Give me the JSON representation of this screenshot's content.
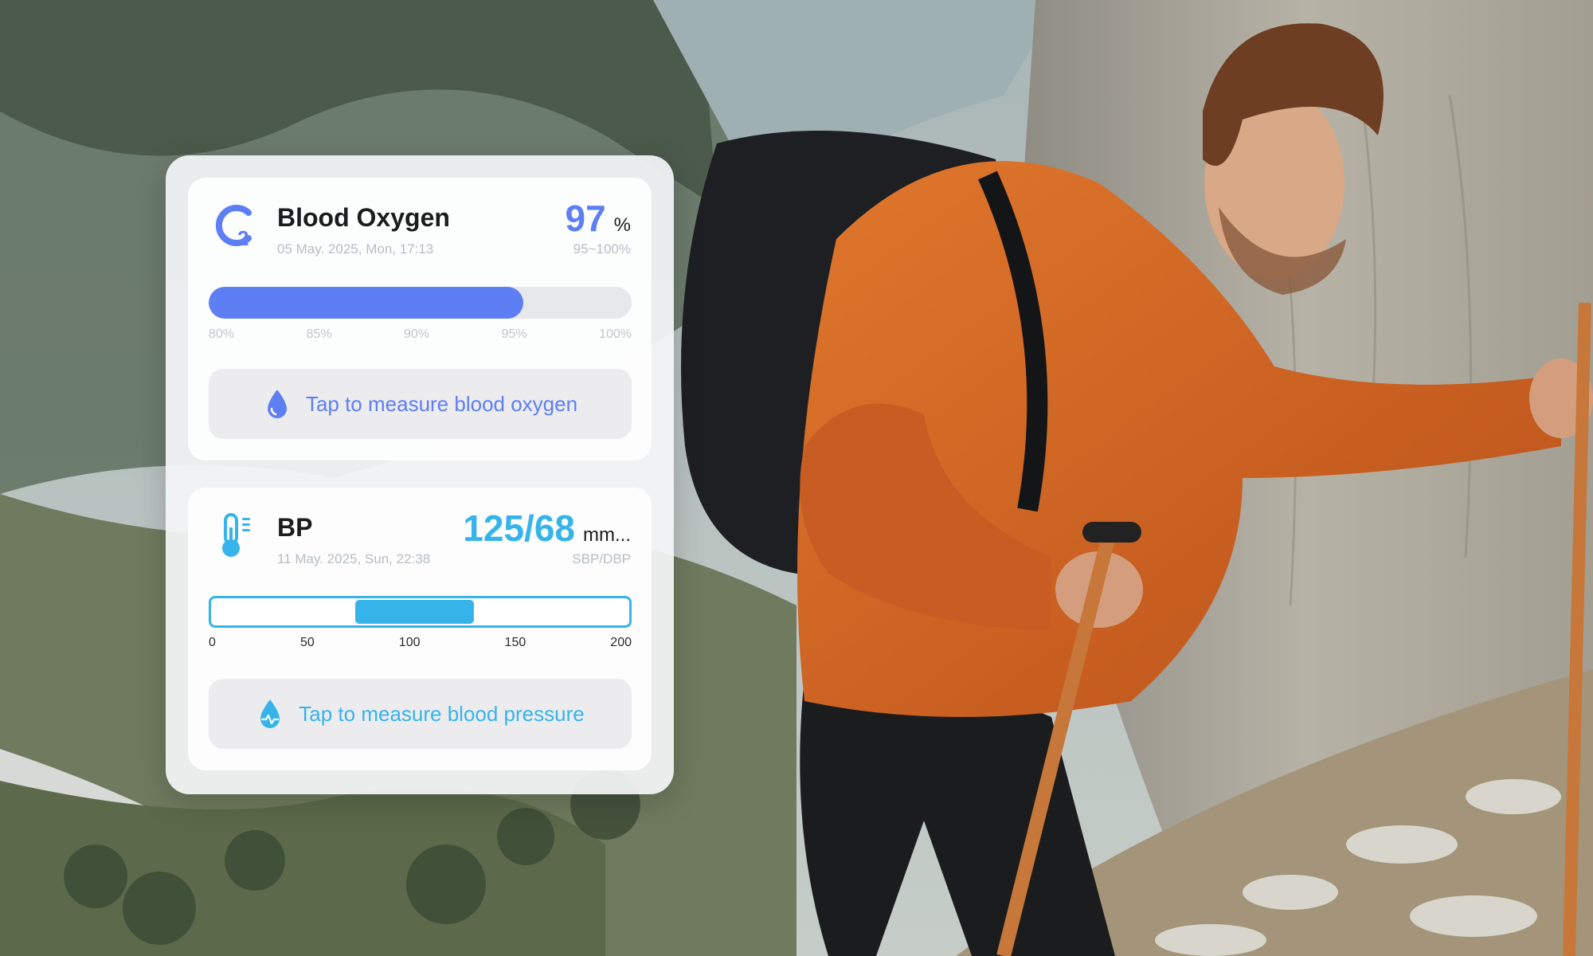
{
  "colors": {
    "oxygen_accent": "#5e7ff3",
    "bp_accent": "#36b4ea",
    "jacket_orange": "#d9661f"
  },
  "blood_oxygen": {
    "icon": "o2-icon",
    "title": "Blood Oxygen",
    "timestamp": "05 May. 2025, Mon, 17:13",
    "value": "97",
    "unit": "%",
    "normal_range": "95~100%",
    "scale_min": 80,
    "scale_max": 100,
    "reading": 97,
    "ticks": [
      "80%",
      "85%",
      "90%",
      "95%",
      "100%"
    ],
    "measure_icon": "water-drop-icon",
    "measure_label": "Tap to measure blood oxygen"
  },
  "blood_pressure": {
    "icon": "thermometer-icon",
    "title": "BP",
    "timestamp": "11 May. 2025, Sun, 22:38",
    "value": "125/68",
    "unit": "mm...",
    "value_caption": "SBP/DBP",
    "scale_min": 0,
    "scale_max": 200,
    "range_low": 68,
    "range_high": 125,
    "ticks": [
      "0",
      "50",
      "100",
      "150",
      "200"
    ],
    "measure_icon": "heartbeat-drop-icon",
    "measure_label": "Tap to measure blood pressure"
  }
}
